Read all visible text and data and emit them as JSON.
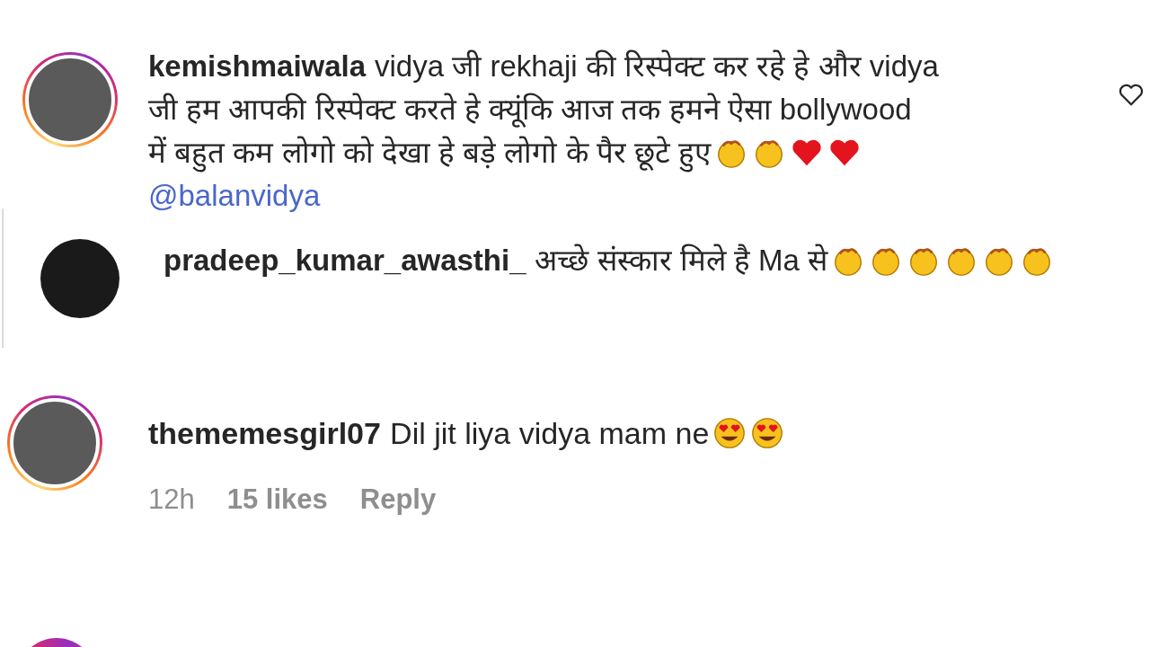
{
  "comments": [
    {
      "username": "kemishmaiwala",
      "lines": [
        "vidya जी rekhaji की रिस्पेक्ट कर रहे हे और vidya",
        "जी हम आपकी रिस्पेक्ट करते हे क्यूंकि आज तक हमने ऐसा bollywood",
        "में बहुत कम लोगो को देखा हे बड़े लोगो के पैर छूटे हुए"
      ],
      "emojis": [
        {
          "kind": "clap"
        },
        {
          "kind": "clap"
        },
        {
          "kind": "heart"
        },
        {
          "kind": "heart"
        }
      ],
      "mention": "@balanvidya",
      "story_ring": true,
      "reply": false,
      "liked": false
    },
    {
      "username": "pradeep_kumar_awasthi_",
      "lines": [
        "अच्छे संस्कार मिले है Ma से"
      ],
      "emojis": [
        {
          "kind": "clap"
        },
        {
          "kind": "clap"
        },
        {
          "kind": "clap"
        },
        {
          "kind": "clap"
        },
        {
          "kind": "clap"
        },
        {
          "kind": "clap"
        }
      ],
      "story_ring": false,
      "reply": true
    },
    {
      "username": "thememesgirl07",
      "lines": [
        "Dil jit liya vidya mam ne"
      ],
      "emojis": [
        {
          "kind": "hearteyes"
        },
        {
          "kind": "hearteyes"
        }
      ],
      "story_ring": true,
      "reply": false,
      "meta": {
        "time": "12h",
        "likes": "15 likes",
        "reply": "Reply"
      }
    }
  ]
}
